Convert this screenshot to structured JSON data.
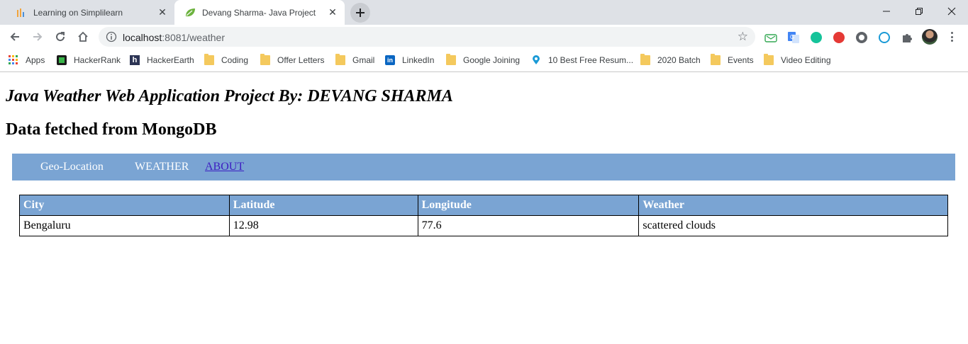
{
  "browser": {
    "tabs": [
      {
        "title": "Learning on Simplilearn",
        "active": false,
        "icon": "simplilearn-icon"
      },
      {
        "title": "Devang Sharma- Java Project",
        "active": true,
        "icon": "spring-leaf-icon"
      }
    ],
    "address": {
      "host": "localhost",
      "rest": ":8081/weather"
    },
    "bookmarks": [
      {
        "label": "Apps",
        "icon": "apps-grid-icon"
      },
      {
        "label": "HackerRank",
        "icon": "hackerrank-icon"
      },
      {
        "label": "HackerEarth",
        "icon": "hackerearth-icon"
      },
      {
        "label": "Coding",
        "icon": "folder-icon"
      },
      {
        "label": "Offer Letters",
        "icon": "folder-icon"
      },
      {
        "label": "Gmail",
        "icon": "folder-icon"
      },
      {
        "label": "LinkedIn",
        "icon": "linkedin-icon"
      },
      {
        "label": "Google Joining",
        "icon": "folder-icon"
      },
      {
        "label": "10 Best Free Resum...",
        "icon": "location-pin-icon"
      },
      {
        "label": "2020 Batch",
        "icon": "folder-icon"
      },
      {
        "label": "Events",
        "icon": "folder-icon"
      },
      {
        "label": "Video Editing",
        "icon": "folder-icon"
      }
    ],
    "colors": {
      "tabstrip": "#dee1e6",
      "omnibox": "#f1f3f4",
      "folder": "#f4c95d"
    }
  },
  "page": {
    "title_italic": "Java Weather Web Application Project By: DEVANG SHARMA",
    "subtitle": "Data fetched from MongoDB",
    "nav": {
      "geo": "Geo-Location",
      "weather": "WEATHER",
      "about": "ABOUT"
    },
    "table": {
      "headers": [
        "City",
        "Latitude",
        "Longitude",
        "Weather"
      ],
      "rows": [
        [
          "Bengaluru",
          "12.98",
          "77.6",
          "scattered clouds"
        ]
      ]
    },
    "colors": {
      "nav_bg": "#7aa4d3",
      "link": "#3d1ec2"
    }
  }
}
